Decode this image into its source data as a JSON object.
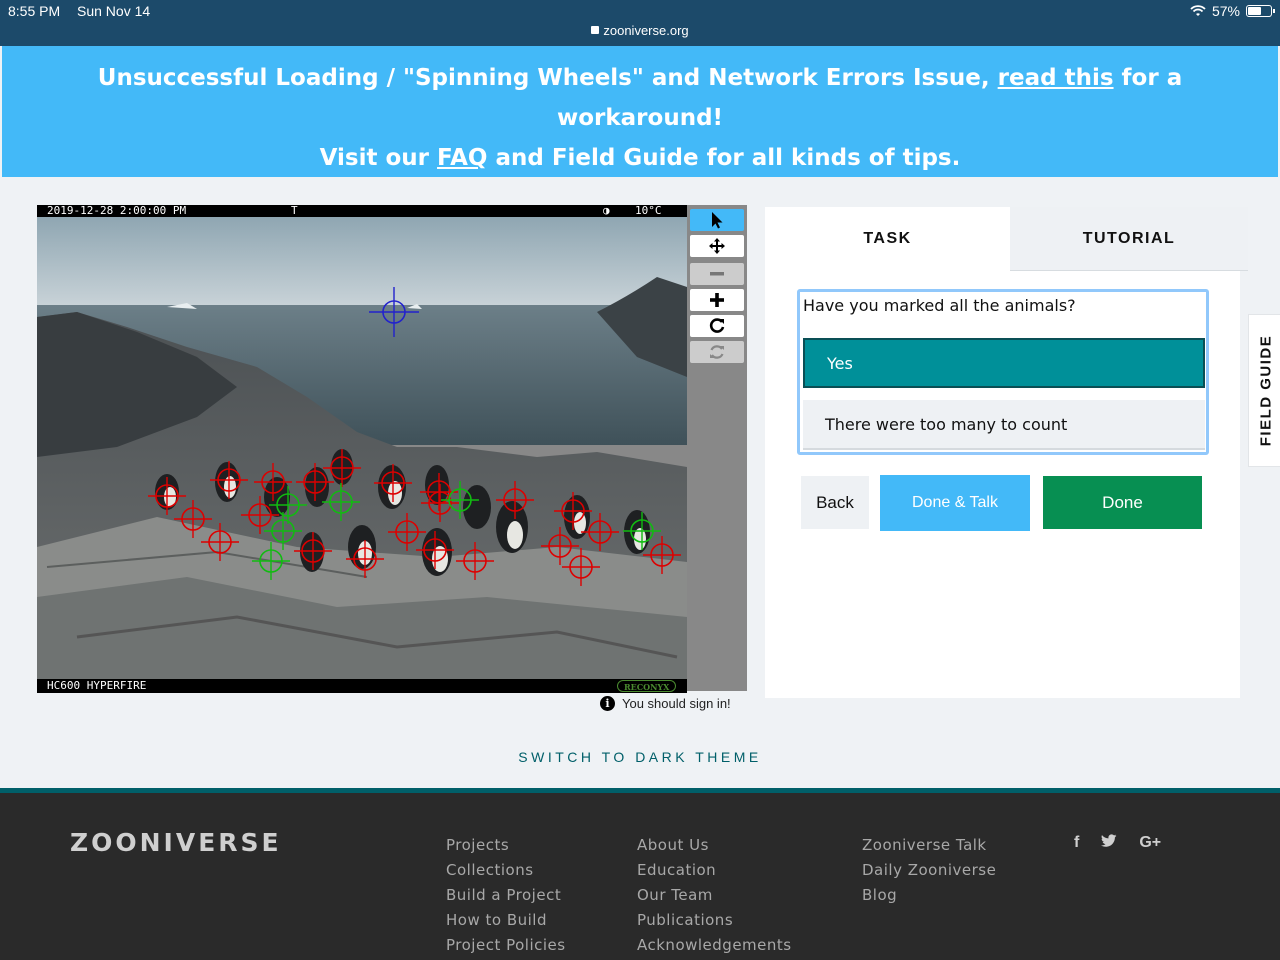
{
  "status_bar": {
    "time": "8:55 PM",
    "date": "Sun Nov 14",
    "url": "zooniverse.org",
    "battery": "57%"
  },
  "banner": {
    "line1_pre": "Unsuccessful Loading / \"Spinning Wheels\" and Network Errors Issue, ",
    "line1_link": "read this",
    "line1_post": " for a",
    "line2": "workaround!",
    "line3_pre": "Visit our ",
    "line3_link": "FAQ",
    "line3_post": " and Field Guide for all kinds of tips."
  },
  "camera": {
    "datetime": "2019-12-28  2:00:00 PM",
    "flag": "T",
    "moon": "◑",
    "temperature": "10°C",
    "model": "HC600 HYPERFIRE",
    "brand": "RECONYX"
  },
  "viewer_tools": [
    {
      "name": "pointer-tool",
      "icon": "cursor-icon",
      "glyph": "➤"
    },
    {
      "name": "move-tool",
      "icon": "move-icon",
      "glyph": "✥"
    },
    {
      "name": "zoom-out-tool",
      "icon": "minus-icon",
      "glyph": "−"
    },
    {
      "name": "zoom-in-tool",
      "icon": "plus-icon",
      "glyph": "+"
    },
    {
      "name": "rotate-tool",
      "icon": "rotate-icon",
      "glyph": "↻"
    },
    {
      "name": "reset-tool",
      "icon": "refresh-icon",
      "glyph": "⟳"
    }
  ],
  "sign_in_notice": "You should sign in!",
  "tabs": {
    "task": "TASK",
    "tutorial": "TUTORIAL"
  },
  "task": {
    "question": "Have you marked all the animals?",
    "answers": [
      "Yes",
      "There were too many to count"
    ],
    "selected": "Yes"
  },
  "buttons": {
    "back": "Back",
    "done_talk": "Done & Talk",
    "done": "Done"
  },
  "field_guide": "FIELD GUIDE",
  "dark_theme": "SWITCH TO DARK THEME",
  "footer": {
    "logo": "ZOONIVERSE",
    "col1": [
      "Projects",
      "Collections",
      "Build a Project",
      "How to Build",
      "Project Policies"
    ],
    "col2": [
      "About Us",
      "Education",
      "Our Team",
      "Publications",
      "Acknowledgements"
    ],
    "col3": [
      "Zooniverse Talk",
      "Daily Zooniverse",
      "Blog"
    ],
    "social": [
      "f",
      "t",
      "G+"
    ]
  },
  "colors": {
    "banner": "#43b9f8",
    "selected_answer": "#009099",
    "done": "#078f52",
    "footer": "#2a2a2a",
    "accent": "#005f69"
  }
}
